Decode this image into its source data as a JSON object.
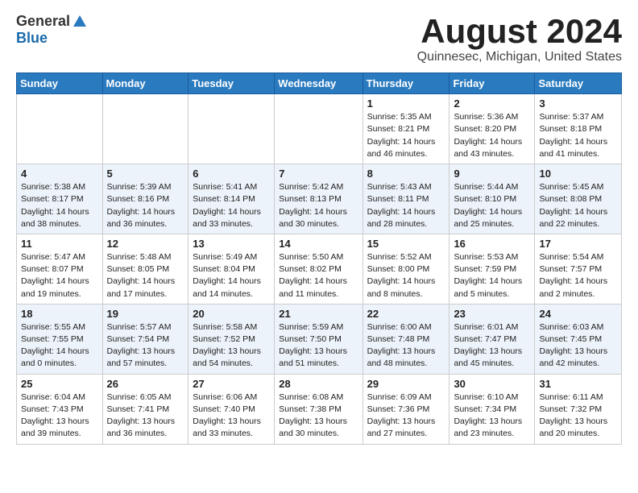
{
  "header": {
    "logo_general": "General",
    "logo_blue": "Blue",
    "month_title": "August 2024",
    "location": "Quinnesec, Michigan, United States"
  },
  "weekdays": [
    "Sunday",
    "Monday",
    "Tuesday",
    "Wednesday",
    "Thursday",
    "Friday",
    "Saturday"
  ],
  "weeks": [
    [
      {
        "day": "",
        "info": ""
      },
      {
        "day": "",
        "info": ""
      },
      {
        "day": "",
        "info": ""
      },
      {
        "day": "",
        "info": ""
      },
      {
        "day": "1",
        "info": "Sunrise: 5:35 AM\nSunset: 8:21 PM\nDaylight: 14 hours\nand 46 minutes."
      },
      {
        "day": "2",
        "info": "Sunrise: 5:36 AM\nSunset: 8:20 PM\nDaylight: 14 hours\nand 43 minutes."
      },
      {
        "day": "3",
        "info": "Sunrise: 5:37 AM\nSunset: 8:18 PM\nDaylight: 14 hours\nand 41 minutes."
      }
    ],
    [
      {
        "day": "4",
        "info": "Sunrise: 5:38 AM\nSunset: 8:17 PM\nDaylight: 14 hours\nand 38 minutes."
      },
      {
        "day": "5",
        "info": "Sunrise: 5:39 AM\nSunset: 8:16 PM\nDaylight: 14 hours\nand 36 minutes."
      },
      {
        "day": "6",
        "info": "Sunrise: 5:41 AM\nSunset: 8:14 PM\nDaylight: 14 hours\nand 33 minutes."
      },
      {
        "day": "7",
        "info": "Sunrise: 5:42 AM\nSunset: 8:13 PM\nDaylight: 14 hours\nand 30 minutes."
      },
      {
        "day": "8",
        "info": "Sunrise: 5:43 AM\nSunset: 8:11 PM\nDaylight: 14 hours\nand 28 minutes."
      },
      {
        "day": "9",
        "info": "Sunrise: 5:44 AM\nSunset: 8:10 PM\nDaylight: 14 hours\nand 25 minutes."
      },
      {
        "day": "10",
        "info": "Sunrise: 5:45 AM\nSunset: 8:08 PM\nDaylight: 14 hours\nand 22 minutes."
      }
    ],
    [
      {
        "day": "11",
        "info": "Sunrise: 5:47 AM\nSunset: 8:07 PM\nDaylight: 14 hours\nand 19 minutes."
      },
      {
        "day": "12",
        "info": "Sunrise: 5:48 AM\nSunset: 8:05 PM\nDaylight: 14 hours\nand 17 minutes."
      },
      {
        "day": "13",
        "info": "Sunrise: 5:49 AM\nSunset: 8:04 PM\nDaylight: 14 hours\nand 14 minutes."
      },
      {
        "day": "14",
        "info": "Sunrise: 5:50 AM\nSunset: 8:02 PM\nDaylight: 14 hours\nand 11 minutes."
      },
      {
        "day": "15",
        "info": "Sunrise: 5:52 AM\nSunset: 8:00 PM\nDaylight: 14 hours\nand 8 minutes."
      },
      {
        "day": "16",
        "info": "Sunrise: 5:53 AM\nSunset: 7:59 PM\nDaylight: 14 hours\nand 5 minutes."
      },
      {
        "day": "17",
        "info": "Sunrise: 5:54 AM\nSunset: 7:57 PM\nDaylight: 14 hours\nand 2 minutes."
      }
    ],
    [
      {
        "day": "18",
        "info": "Sunrise: 5:55 AM\nSunset: 7:55 PM\nDaylight: 14 hours\nand 0 minutes."
      },
      {
        "day": "19",
        "info": "Sunrise: 5:57 AM\nSunset: 7:54 PM\nDaylight: 13 hours\nand 57 minutes."
      },
      {
        "day": "20",
        "info": "Sunrise: 5:58 AM\nSunset: 7:52 PM\nDaylight: 13 hours\nand 54 minutes."
      },
      {
        "day": "21",
        "info": "Sunrise: 5:59 AM\nSunset: 7:50 PM\nDaylight: 13 hours\nand 51 minutes."
      },
      {
        "day": "22",
        "info": "Sunrise: 6:00 AM\nSunset: 7:48 PM\nDaylight: 13 hours\nand 48 minutes."
      },
      {
        "day": "23",
        "info": "Sunrise: 6:01 AM\nSunset: 7:47 PM\nDaylight: 13 hours\nand 45 minutes."
      },
      {
        "day": "24",
        "info": "Sunrise: 6:03 AM\nSunset: 7:45 PM\nDaylight: 13 hours\nand 42 minutes."
      }
    ],
    [
      {
        "day": "25",
        "info": "Sunrise: 6:04 AM\nSunset: 7:43 PM\nDaylight: 13 hours\nand 39 minutes."
      },
      {
        "day": "26",
        "info": "Sunrise: 6:05 AM\nSunset: 7:41 PM\nDaylight: 13 hours\nand 36 minutes."
      },
      {
        "day": "27",
        "info": "Sunrise: 6:06 AM\nSunset: 7:40 PM\nDaylight: 13 hours\nand 33 minutes."
      },
      {
        "day": "28",
        "info": "Sunrise: 6:08 AM\nSunset: 7:38 PM\nDaylight: 13 hours\nand 30 minutes."
      },
      {
        "day": "29",
        "info": "Sunrise: 6:09 AM\nSunset: 7:36 PM\nDaylight: 13 hours\nand 27 minutes."
      },
      {
        "day": "30",
        "info": "Sunrise: 6:10 AM\nSunset: 7:34 PM\nDaylight: 13 hours\nand 23 minutes."
      },
      {
        "day": "31",
        "info": "Sunrise: 6:11 AM\nSunset: 7:32 PM\nDaylight: 13 hours\nand 20 minutes."
      }
    ]
  ]
}
